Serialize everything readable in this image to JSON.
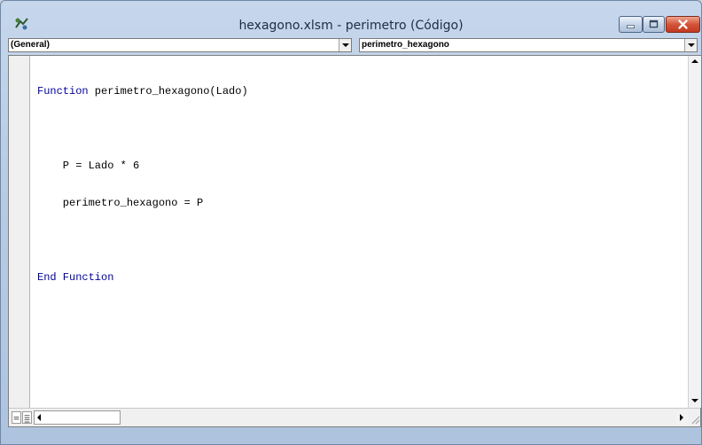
{
  "window": {
    "title": "hexagono.xlsm - perimetro (Código)"
  },
  "toolbar": {
    "object_combo": "(General)",
    "procedure_combo": "perimetro_hexagono"
  },
  "code": {
    "lines": [
      {
        "keyword": "Function",
        "text": " perimetro_hexagono(Lado)"
      },
      {
        "keyword": "",
        "text": ""
      },
      {
        "keyword": "",
        "text": "    P = Lado * 6"
      },
      {
        "keyword": "",
        "text": "    perimetro_hexagono = P"
      },
      {
        "keyword": "",
        "text": ""
      },
      {
        "keyword": "End Function",
        "text": ""
      }
    ]
  },
  "colors": {
    "keyword": "#0000a0",
    "title_bar": "#b8cce4",
    "close_button": "#c3391f"
  },
  "icons": {
    "app": "vba-project-icon",
    "minimize": "minimize-icon",
    "maximize": "maximize-icon",
    "close": "close-icon"
  }
}
